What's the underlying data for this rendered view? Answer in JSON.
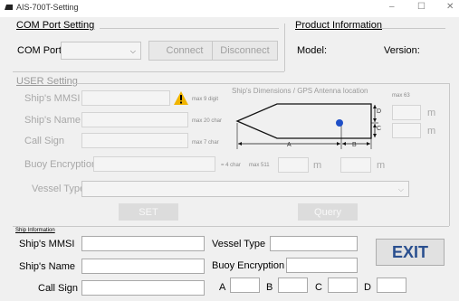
{
  "window": {
    "title": "AIS-700T-Setting",
    "minimize": "–",
    "maximize": "☐",
    "close": "✕"
  },
  "com_port": {
    "group_title": "COM Port Setting",
    "port_label": "COM Port",
    "port_value": "",
    "connect_label": "Connect",
    "disconnect_label": "Disconnect"
  },
  "product": {
    "group_title": "Product Information",
    "model_label": "Model:",
    "version_label": "Version:"
  },
  "user_setting": {
    "group_title": "USER Setting",
    "mmsi_label": "Ship's MMSI",
    "mmsi_hint": "max 9 digit",
    "name_label": "Ship's Name",
    "name_hint": "max 20 char",
    "callsign_label": "Call Sign",
    "callsign_hint": "max 7 char",
    "buoy_label": "Buoy Encryption",
    "buoy_hint": "= 4 char",
    "vessel_type_label": "Vessel Type",
    "set_label": "SET",
    "query_label": "Query",
    "dims_title": "Ship's Dimensions / GPS Antenna location",
    "dim_a": "A",
    "dim_b": "B",
    "dim_c": "C",
    "dim_d": "D",
    "max63": "max 63",
    "max511": "max 511",
    "unit_m": "m",
    "warning_icon": "warning-icon"
  },
  "ship_info": {
    "group_title": "Ship Information",
    "mmsi_label": "Ship's MMSI",
    "name_label": "Ship's Name",
    "callsign_label": "Call Sign",
    "vessel_type_label": "Vessel Type",
    "buoy_label": "Buoy Encryption",
    "a_label": "A",
    "b_label": "B",
    "c_label": "C",
    "d_label": "D",
    "exit_label": "EXIT"
  },
  "colors": {
    "exit_text": "#2a4f8f",
    "gps_dot": "#1f4fc7",
    "warning": "#f0b400"
  }
}
